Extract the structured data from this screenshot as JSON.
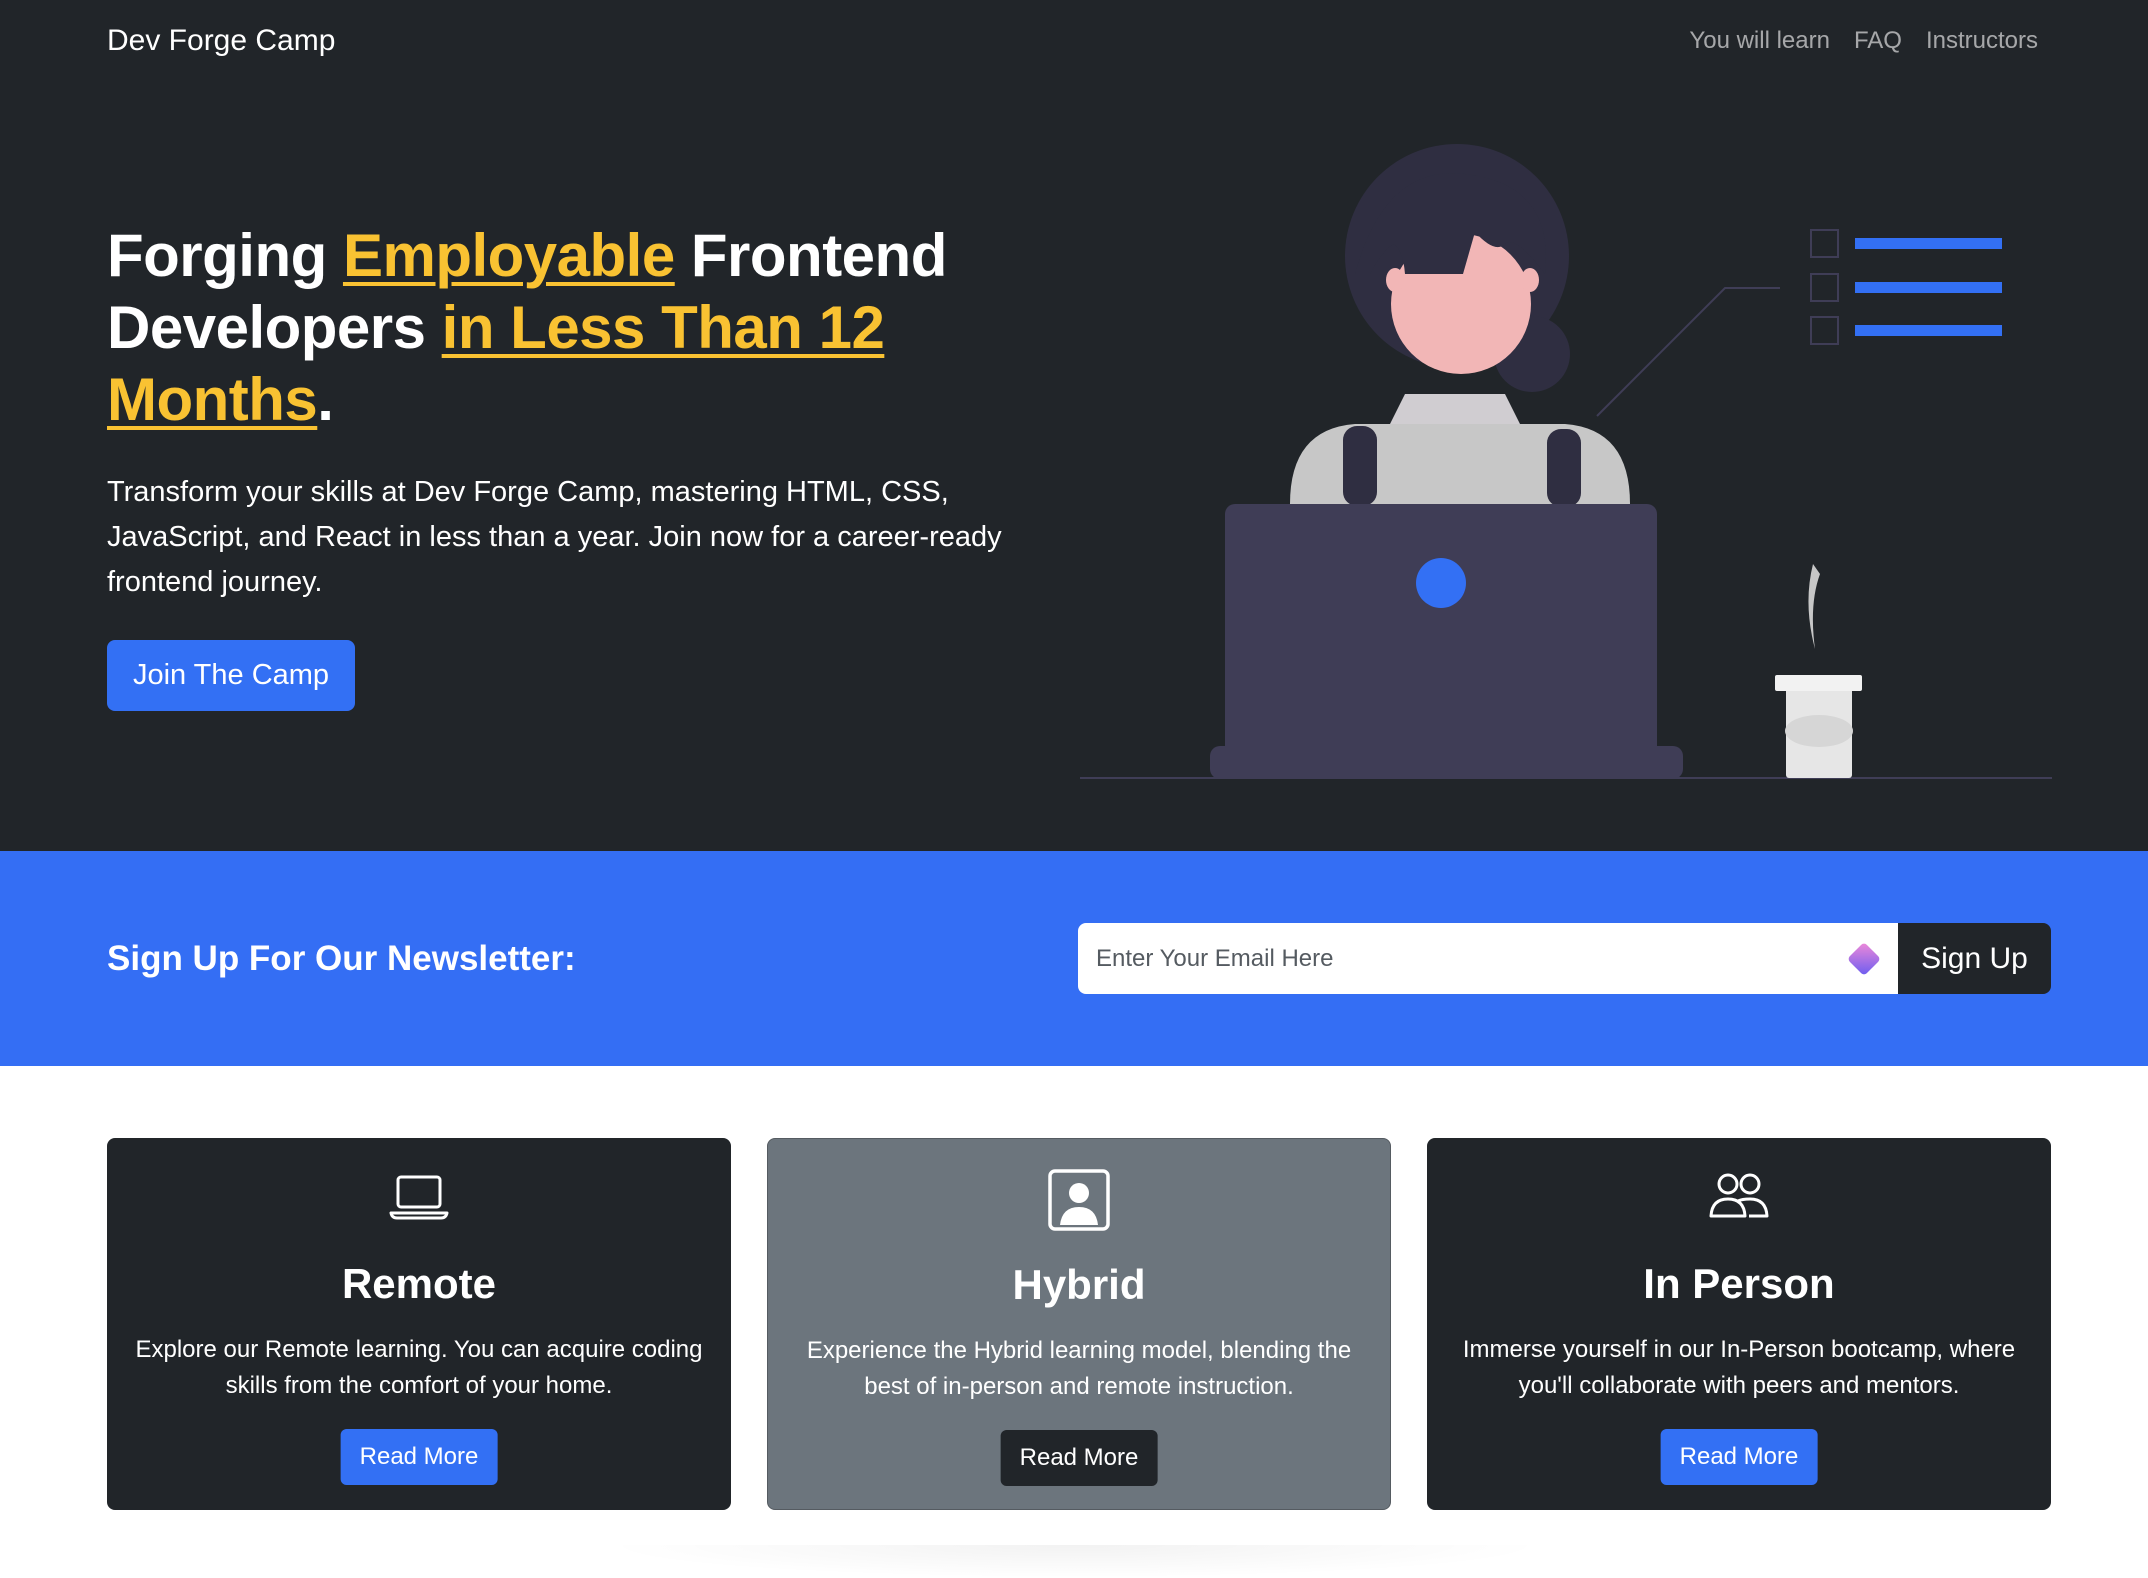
{
  "navbar": {
    "brand": "Dev Forge Camp",
    "links": [
      "You will learn",
      "FAQ",
      "Instructors"
    ]
  },
  "hero": {
    "title_part1": "Forging ",
    "title_highlight1": "Employable",
    "title_part2": " Frontend Developers ",
    "title_highlight2": "in Less Than 12 Months",
    "title_part3": ".",
    "lead": "Transform your skills at Dev Forge Camp, mastering HTML, CSS, JavaScript, and React in less than a year. Join now for a career-ready frontend journey.",
    "cta_label": "Join The Camp"
  },
  "newsletter": {
    "heading": "Sign Up For Our Newsletter:",
    "input_placeholder": "Enter Your Email Here",
    "button_label": "Sign Up"
  },
  "cards": [
    {
      "icon": "laptop-icon",
      "title": "Remote",
      "text": "Explore our Remote learning. You can acquire coding skills from the comfort of your home.",
      "button_label": "Read More"
    },
    {
      "icon": "person-badge-icon",
      "title": "Hybrid",
      "text": "Experience the Hybrid learning model, blending the best of in-person and remote instruction.",
      "button_label": "Read More"
    },
    {
      "icon": "people-icon",
      "title": "In Person",
      "text": "Immerse yourself in our In-Person bootcamp, where you'll collaborate with peers and mentors.",
      "button_label": "Read More"
    }
  ],
  "colors": {
    "dark": "#212529",
    "primary": "#3370f4",
    "highlight": "#f9c232",
    "secondary": "#6c757d"
  }
}
